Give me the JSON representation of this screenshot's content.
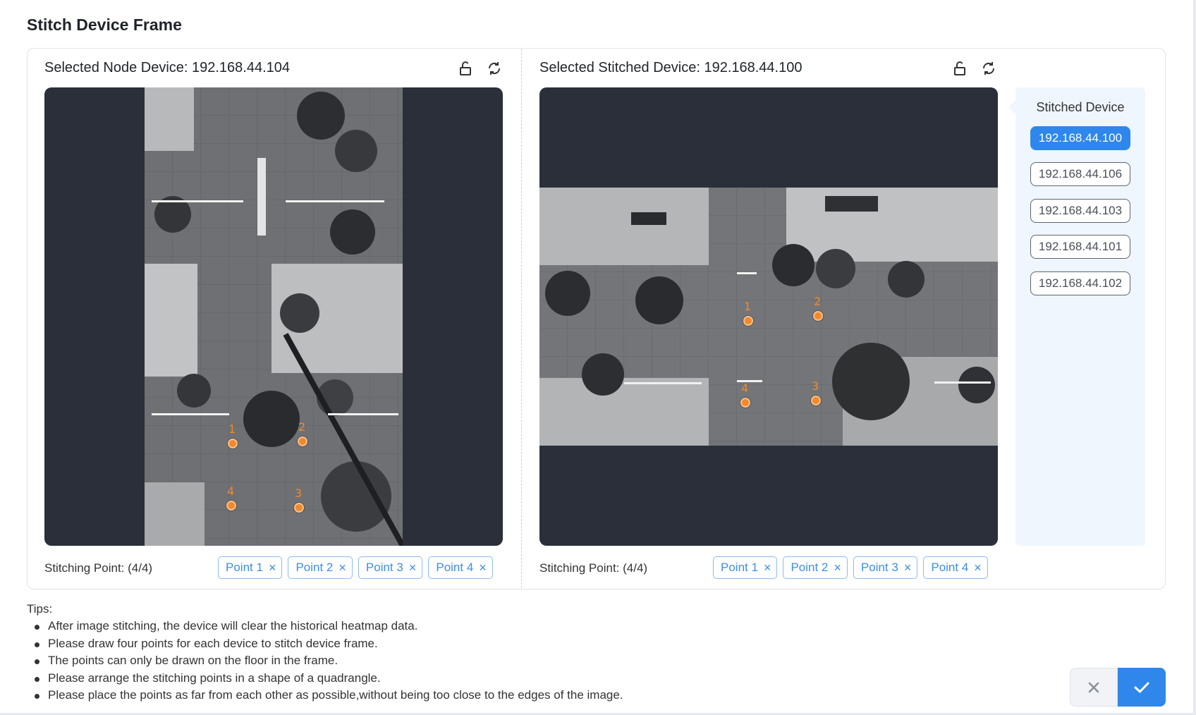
{
  "dialog": {
    "title": "Stitch Device Frame"
  },
  "node_panel": {
    "title": "Selected Node Device: 192.168.44.104",
    "stitching_label": "Stitching Point: (4/4)",
    "point_numbers": [
      "1",
      "2",
      "3",
      "4"
    ],
    "tags": [
      "Point 1",
      "Point 2",
      "Point 3",
      "Point 4"
    ]
  },
  "stitched_panel": {
    "title": "Selected Stitched Device: 192.168.44.100",
    "stitching_label": "Stitching Point: (4/4)",
    "point_numbers": [
      "1",
      "2",
      "3",
      "4"
    ],
    "tags": [
      "Point 1",
      "Point 2",
      "Point 3",
      "Point 4"
    ]
  },
  "stitched_list": {
    "title": "Stitched Device",
    "devices": [
      "192.168.44.100",
      "192.168.44.106",
      "192.168.44.103",
      "192.168.44.101",
      "192.168.44.102"
    ],
    "selected": "192.168.44.100"
  },
  "tips": {
    "title": "Tips:",
    "items": [
      "After image stitching, the device will clear the historical heatmap data.",
      "Please draw four points for each device to stitch device frame.",
      "The points can only be drawn on the floor in the frame.",
      "Please arrange the stitching points in a shape of a quadrangle.",
      "Please place the points as far from each other as possible,without being too close to the edges of the image."
    ]
  },
  "colors": {
    "accent": "#2f87eb",
    "point_marker": "#f08a2c",
    "viewer_bg": "#2a2f39"
  },
  "icons": {
    "unlock": "unlock-icon",
    "refresh": "refresh-icon",
    "close": "close-icon",
    "confirm": "check-icon"
  }
}
